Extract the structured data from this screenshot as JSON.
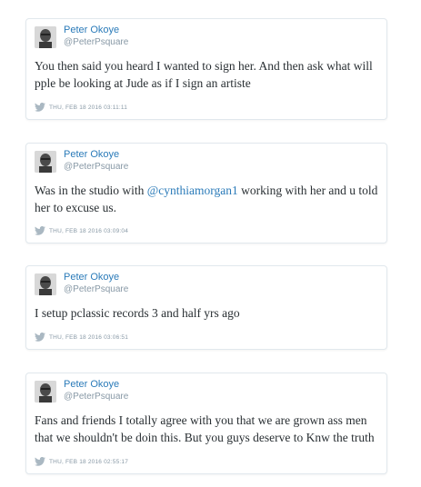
{
  "colors": {
    "link": "#2b7bb9",
    "muted": "#8899a6",
    "text": "#292f33",
    "border": "#e1e8ed"
  },
  "tweets": [
    {
      "author": "Peter Okoye",
      "handle": "@PeterPsquare",
      "text": "You then said you heard I wanted to sign her. And then ask what will pple be looking at Jude as if I sign an artiste",
      "timestamp": "THU, FEB 18 2016 03:11:11"
    },
    {
      "author": "Peter Okoye",
      "handle": "@PeterPsquare",
      "text_before": "Was in the studio with ",
      "mention": "@cynthiamorgan1",
      "text_after": " working with her and u told her to excuse us.",
      "timestamp": "THU, FEB 18 2016 03:09:04"
    },
    {
      "author": "Peter Okoye",
      "handle": "@PeterPsquare",
      "text": "I setup pclassic records 3 and half yrs ago",
      "timestamp": "THU, FEB 18 2016 03:06:51"
    },
    {
      "author": "Peter Okoye",
      "handle": "@PeterPsquare",
      "text": "Fans and friends I totally agree with you that we are grown ass men that we shouldn't be doin this. But you guys deserve to Knw the truth",
      "timestamp": "THU, FEB 18 2016 02:55:17"
    }
  ],
  "icons": {
    "avatar": "user-avatar",
    "bird": "twitter-bird-icon"
  }
}
